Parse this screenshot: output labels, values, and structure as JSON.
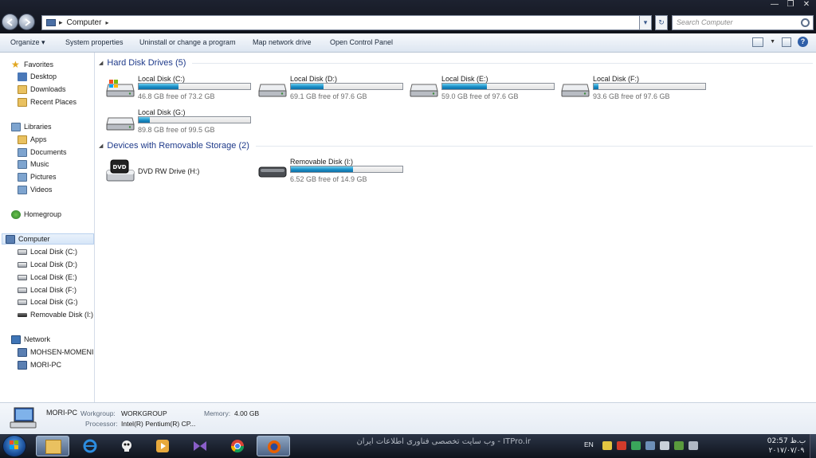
{
  "window": {
    "breadcrumb": "Computer",
    "search_placeholder": "Search Computer",
    "controls": [
      "—",
      "❐",
      "✕"
    ]
  },
  "toolbar": {
    "organize": "Organize ▾",
    "system_properties": "System properties",
    "uninstall": "Uninstall or change a program",
    "map_drive": "Map network drive",
    "control_panel": "Open Control Panel"
  },
  "nav": {
    "favorites": "Favorites",
    "desktop": "Desktop",
    "downloads": "Downloads",
    "recent": "Recent Places",
    "libraries": "Libraries",
    "apps": "Apps",
    "documents": "Documents",
    "music": "Music",
    "pictures": "Pictures",
    "videos": "Videos",
    "homegroup": "Homegroup",
    "computer": "Computer",
    "c": "Local Disk (C:)",
    "d": "Local Disk (D:)",
    "e": "Local Disk (E:)",
    "f": "Local Disk (F:)",
    "g": "Local Disk (G:)",
    "i": "Removable Disk (I:)",
    "network": "Network",
    "pc1": "MOHSEN-MOMENI",
    "pc2": "MORI-PC"
  },
  "groups": {
    "hdd": "Hard Disk Drives (5)",
    "removable": "Devices with Removable Storage (2)"
  },
  "drives": [
    {
      "name": "Local Disk (C:)",
      "free": "46.8 GB free of 73.2 GB",
      "used_fraction": 0.36
    },
    {
      "name": "Local Disk (D:)",
      "free": "69.1 GB free of 97.6 GB",
      "used_fraction": 0.29
    },
    {
      "name": "Local Disk (E:)",
      "free": "59.0 GB free of 97.6 GB",
      "used_fraction": 0.4
    },
    {
      "name": "Local Disk (F:)",
      "free": "93.6 GB free of 97.6 GB",
      "used_fraction": 0.04
    },
    {
      "name": "Local Disk (G:)",
      "free": "89.8 GB free of 99.5 GB",
      "used_fraction": 0.1
    }
  ],
  "removable": [
    {
      "name": "DVD RW Drive (H:)"
    },
    {
      "name": "Removable Disk (I:)",
      "free": "6.52 GB free of 14.9 GB",
      "used_fraction": 0.56
    }
  ],
  "details": {
    "name": "MORI-PC",
    "workgroup_label": "Workgroup:",
    "workgroup": "WORKGROUP",
    "memory_label": "Memory:",
    "memory": "4.00 GB",
    "processor_label": "Processor:",
    "processor": "Intel(R) Pentium(R) CP..."
  },
  "taskbar": {
    "watermark": "ITPro.ir - وب سایت تخصصی فناوری اطلاعات ایران",
    "lang": "EN",
    "time": "02:57 ب.ظ",
    "date": "۲۰۱۷/۰۷/۰۹"
  },
  "colors": {
    "accent": "#1e3a8a",
    "bar_fill": "#1a8ec6"
  }
}
